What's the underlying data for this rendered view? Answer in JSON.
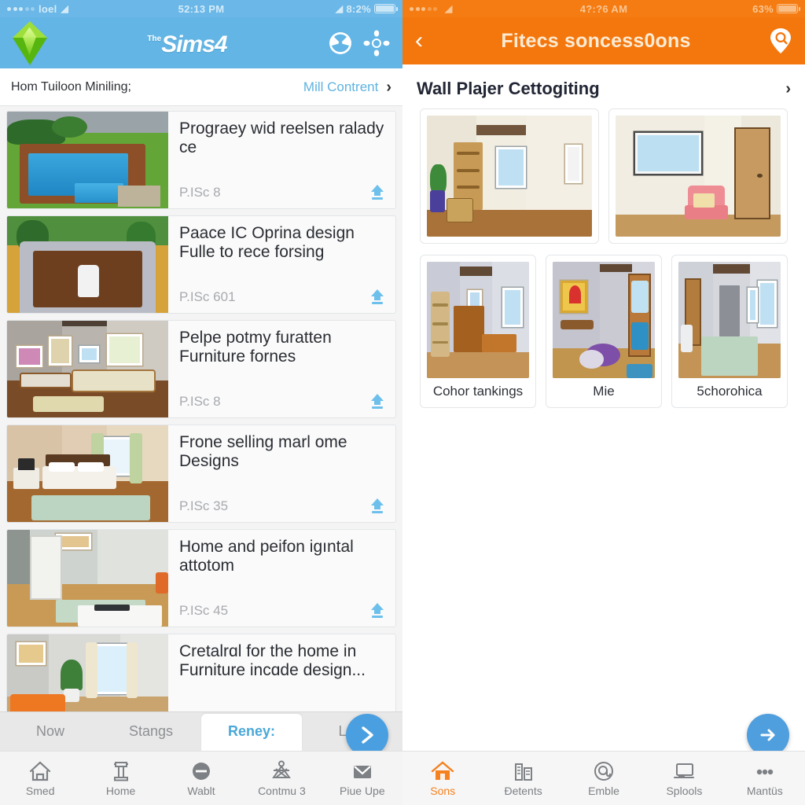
{
  "left": {
    "status_bar": {
      "carrier": "loel",
      "signal_dots": 5,
      "wifi_icon": "wifi-icon",
      "time": "52:13 PM",
      "battery_pct": "8:2%",
      "battery_icon": "battery-icon"
    },
    "app_header": {
      "logo_icon": "plumbob-icon",
      "title_the": "The",
      "title": "Sims4",
      "icon_filter": "compass-filter-icon",
      "icon_move": "pan-move-icon"
    },
    "subhead": {
      "title": "Hom Tuiloon Miniling;",
      "link": "Mill Contrent",
      "chevron": "chevron-right-icon"
    },
    "list": [
      {
        "title": "Prograey wid reelsen ralady ce",
        "sub": "P.ISc 8",
        "scene": "pool",
        "download_icon": "download-icon"
      },
      {
        "title": "Paace IC Oprina design Fulle to rece forsing",
        "sub": "P.ISc 601",
        "scene": "pit",
        "download_icon": "download-icon"
      },
      {
        "title": "Pelpe potmy furatten Furniture fornes",
        "sub": "P.ISc 8",
        "scene": "living",
        "download_icon": "download-icon"
      },
      {
        "title": "Frone selling marl ome Designs",
        "sub": "P.ISc 35",
        "scene": "bedroom",
        "download_icon": "download-icon"
      },
      {
        "title": "Home and peifon igıntal attotom",
        "sub": "P.ISc 45",
        "scene": "hall",
        "download_icon": "download-icon"
      },
      {
        "title": "Cretalrɑl for the home in Furniture incɑde design...",
        "sub": "",
        "scene": "orange",
        "download_icon": "download-icon"
      }
    ],
    "tabs": [
      {
        "label": "Now",
        "active": false
      },
      {
        "label": "Stangs",
        "active": false
      },
      {
        "label": "Reney:",
        "active": true
      },
      {
        "label": "Loɡ:",
        "active": false
      }
    ],
    "fab": {
      "icon": "chevron-right-send-icon"
    },
    "bottom_nav": [
      {
        "label": "Smed",
        "icon": "home-outline-icon",
        "active": false
      },
      {
        "label": "Home",
        "icon": "podium-icon",
        "active": false
      },
      {
        "label": "Wablt",
        "icon": "minus-circle-icon",
        "active": false
      },
      {
        "label": "Contmu 3",
        "icon": "star-person-icon",
        "active": false
      },
      {
        "label": "Piue Upe",
        "icon": "envelope-icon",
        "active": false
      }
    ]
  },
  "right": {
    "status_bar": {
      "carrier": "",
      "signal_dots": 5,
      "wifi_icon": "wifi-icon",
      "time": "4?:?6 AM",
      "battery_pct": "63%",
      "battery_icon": "battery-icon"
    },
    "header": {
      "back_icon": "back-chevron-icon",
      "title": "Fitecs soncess0ons",
      "action_icon": "search-pin-icon"
    },
    "section": {
      "title": "Wall Plajer Cettogiting",
      "chevron": "chevron-right-icon"
    },
    "featured": [
      {
        "caption": "",
        "scene": "shelfroom"
      },
      {
        "caption": "",
        "scene": "chairroom"
      }
    ],
    "cards": [
      {
        "caption": "Cohor tankings",
        "scene": "dresser"
      },
      {
        "caption": "Mie",
        "scene": "heartroom"
      },
      {
        "caption": "5chorohica",
        "scene": "hallway"
      }
    ],
    "fab": {
      "icon": "arrow-right-icon"
    },
    "bottom_nav": [
      {
        "label": "Sons",
        "icon": "home-filled-icon",
        "active": true
      },
      {
        "label": "Đetents",
        "icon": "city-icon",
        "active": false
      },
      {
        "label": "Emble",
        "icon": "at-target-icon",
        "active": false
      },
      {
        "label": "Splools",
        "icon": "laptop-icon",
        "active": false
      },
      {
        "label": "Mantüs",
        "icon": "more-dots-icon",
        "active": false
      }
    ]
  },
  "colors": {
    "left_header": "#62b5e5",
    "left_status": "#6ab7e8",
    "right_header": "#f4770d",
    "right_status": "#f57c12",
    "accent_blue": "#4a9fe0",
    "accent_orange": "#f5811f",
    "tab_active": "#4aa8d8",
    "download": "#6ec0ec"
  }
}
